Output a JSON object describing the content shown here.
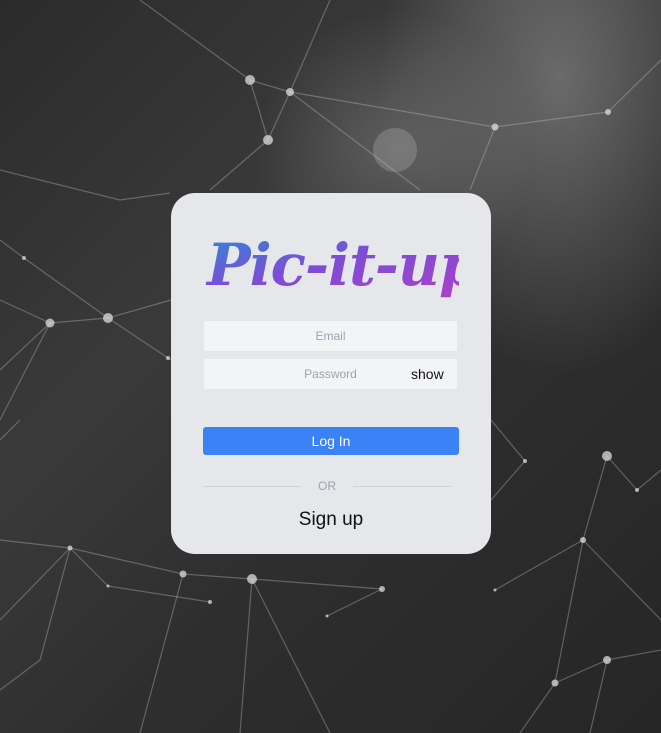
{
  "app": {
    "logo_text": "Pic-it-up",
    "brand_gradient": [
      "#2b8ad8",
      "#7c4dd6",
      "#b03fc7"
    ]
  },
  "form": {
    "email_placeholder": "Email",
    "password_placeholder": "Password",
    "show_label": "show",
    "login_label": "Log In",
    "or_label": "OR",
    "signup_label": "Sign up"
  },
  "colors": {
    "card_bg": "#e5e7eb",
    "input_bg": "#f3f4f6",
    "accent": "#3b82f6"
  }
}
